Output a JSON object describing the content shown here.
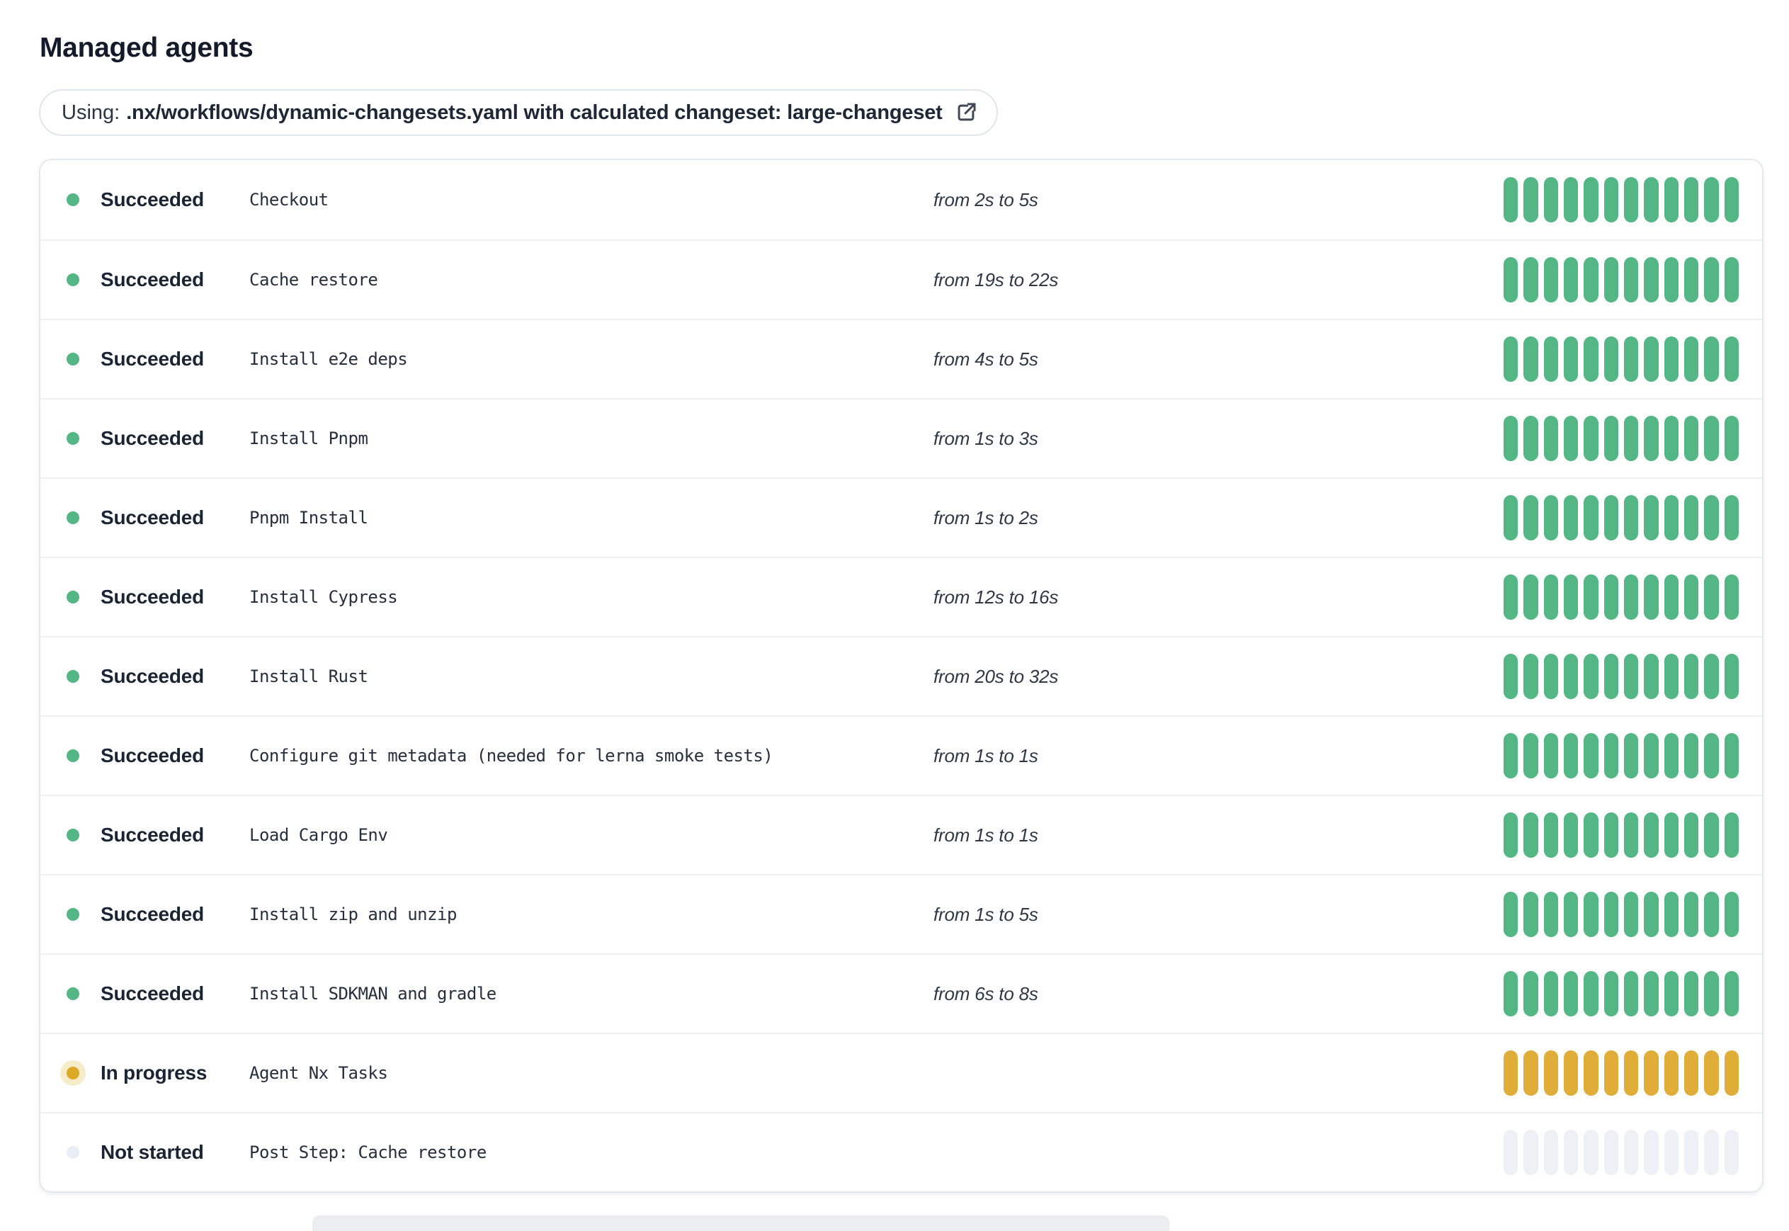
{
  "page": {
    "title": "Managed agents"
  },
  "workflow_badge": {
    "prefix": "Using:",
    "detail": ".nx/workflows/dynamic-changesets.yaml with calculated changeset: large-changeset",
    "icon": "external-link-icon"
  },
  "agents_table": {
    "segments_per_progress_bar": 12,
    "rows": [
      {
        "status_label": "Succeeded",
        "state": "succeeded",
        "step_name": "Checkout",
        "duration": "from 2s to 5s"
      },
      {
        "status_label": "Succeeded",
        "state": "succeeded",
        "step_name": "Cache restore",
        "duration": "from 19s to 22s"
      },
      {
        "status_label": "Succeeded",
        "state": "succeeded",
        "step_name": "Install e2e deps",
        "duration": "from 4s to 5s"
      },
      {
        "status_label": "Succeeded",
        "state": "succeeded",
        "step_name": "Install Pnpm",
        "duration": "from 1s to 3s"
      },
      {
        "status_label": "Succeeded",
        "state": "succeeded",
        "step_name": "Pnpm Install",
        "duration": "from 1s to 2s"
      },
      {
        "status_label": "Succeeded",
        "state": "succeeded",
        "step_name": "Install Cypress",
        "duration": "from 12s to 16s"
      },
      {
        "status_label": "Succeeded",
        "state": "succeeded",
        "step_name": "Install Rust",
        "duration": "from 20s to 32s"
      },
      {
        "status_label": "Succeeded",
        "state": "succeeded",
        "step_name": "Configure git metadata (needed for lerna smoke tests)",
        "duration": "from 1s to 1s"
      },
      {
        "status_label": "Succeeded",
        "state": "succeeded",
        "step_name": "Load Cargo Env",
        "duration": "from 1s to 1s"
      },
      {
        "status_label": "Succeeded",
        "state": "succeeded",
        "step_name": "Install zip and unzip",
        "duration": "from 1s to 5s"
      },
      {
        "status_label": "Succeeded",
        "state": "succeeded",
        "step_name": "Install SDKMAN and gradle",
        "duration": "from 6s to 8s"
      },
      {
        "status_label": "In progress",
        "state": "in_progress",
        "step_name": "Agent Nx Tasks",
        "duration": ""
      },
      {
        "status_label": "Not started",
        "state": "not_started",
        "step_name": "Post Step: Cache restore",
        "duration": ""
      }
    ]
  },
  "colors": {
    "succeeded": "#55b685",
    "in_progress": "#dfad38",
    "in_progress_dot_halo": "#f6ecca",
    "not_started": "#edf1f6",
    "text_dark": "#1b2433",
    "card_border": "#e5e8ec"
  }
}
